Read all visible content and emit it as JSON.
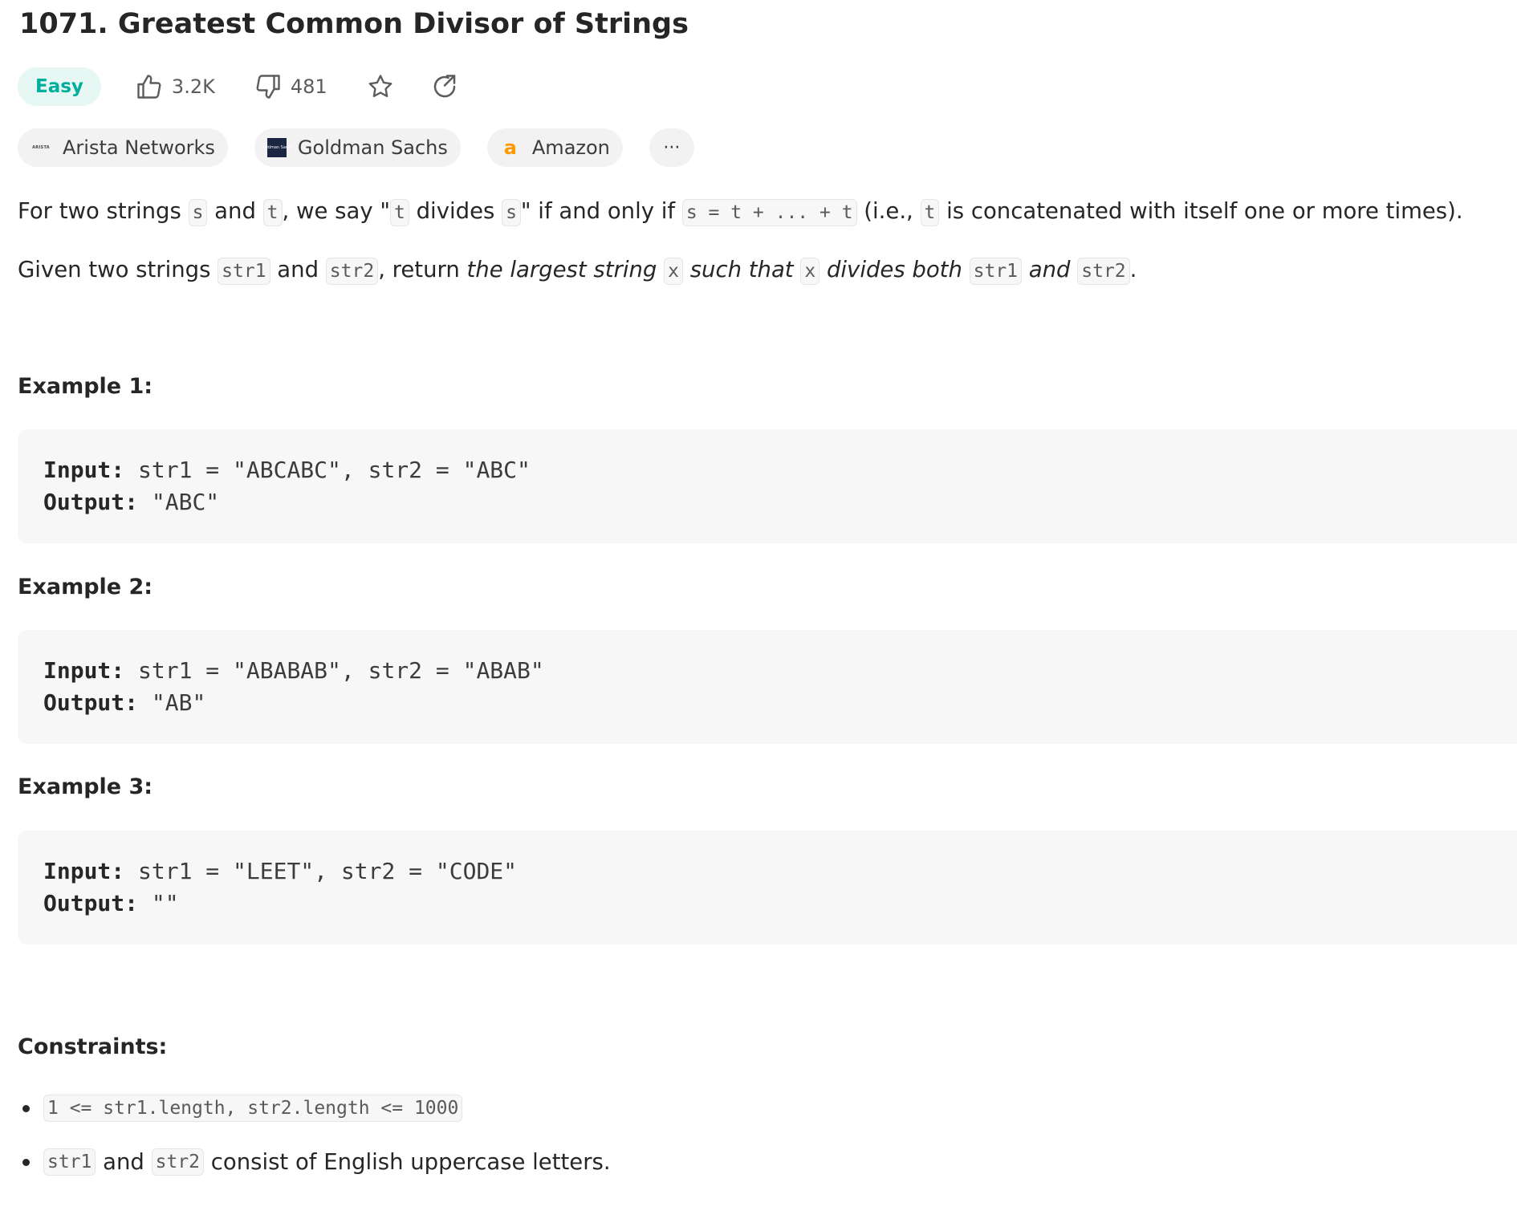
{
  "problem": {
    "title": "1071. Greatest Common Divisor of Strings",
    "difficulty": "Easy",
    "likes": "3.2K",
    "dislikes": "481",
    "companies": [
      "Arista Networks",
      "Goldman Sachs",
      "Amazon"
    ],
    "more_label": "···"
  },
  "icons": {
    "like": "thumbs-up-icon",
    "dislike": "thumbs-down-icon",
    "favorite": "star-icon",
    "share": "share-icon"
  },
  "logos": {
    "arista": "ARISTA",
    "goldman": "Goldman Sachs",
    "amazon": "a"
  },
  "description": {
    "p1": [
      "For two strings ",
      "s",
      " and ",
      "t",
      ", we say \"",
      "t",
      " divides ",
      "s",
      "\" if and only if ",
      "s = t + ... + t",
      " (i.e., ",
      "t",
      " is concatenated with itself one or more times)."
    ],
    "p2": [
      "Given two strings ",
      "str1",
      " and ",
      "str2",
      ", return ",
      "the largest string ",
      "x",
      " such that ",
      "x",
      " divides both ",
      "str1",
      " and ",
      "str2",
      "."
    ]
  },
  "examples": [
    {
      "heading": "Example 1:",
      "input_label": "Input:",
      "input": " str1 = \"ABCABC\", str2 = \"ABC\"",
      "output_label": "Output:",
      "output": " \"ABC\""
    },
    {
      "heading": "Example 2:",
      "input_label": "Input:",
      "input": " str1 = \"ABABAB\", str2 = \"ABAB\"",
      "output_label": "Output:",
      "output": " \"AB\""
    },
    {
      "heading": "Example 3:",
      "input_label": "Input:",
      "input": " str1 = \"LEET\", str2 = \"CODE\"",
      "output_label": "Output:",
      "output": " \"\""
    }
  ],
  "constraints": {
    "heading": "Constraints:",
    "item1_code": "1 <= str1.length, str2.length <= 1000",
    "item2": [
      "str1",
      " and ",
      "str2",
      " consist of English uppercase letters."
    ]
  },
  "colors": {
    "easy_text": "#00af9b",
    "easy_bg": "#e6f7f4",
    "tag_bg": "#f2f2f2",
    "code_bg": "#f7f7f7",
    "amazon_orange": "#ff9900"
  }
}
